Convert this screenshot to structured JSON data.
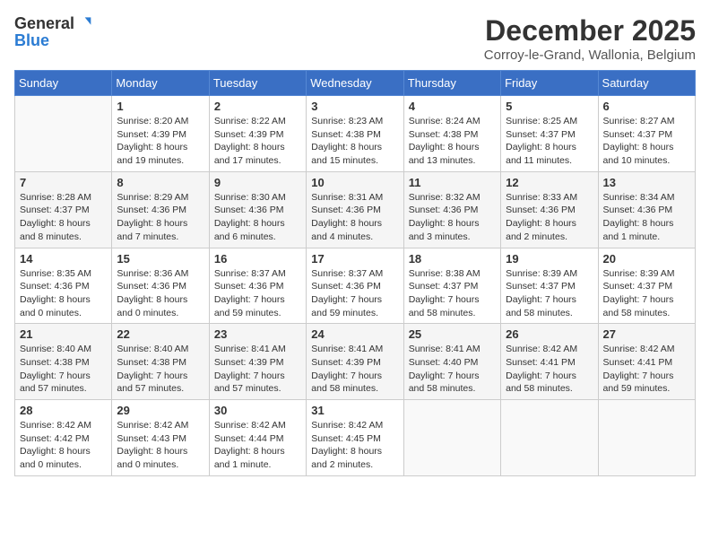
{
  "logo": {
    "text1": "General",
    "text2": "Blue"
  },
  "title": "December 2025",
  "subtitle": "Corroy-le-Grand, Wallonia, Belgium",
  "days_of_week": [
    "Sunday",
    "Monday",
    "Tuesday",
    "Wednesday",
    "Thursday",
    "Friday",
    "Saturday"
  ],
  "weeks": [
    [
      {
        "day": "",
        "info": ""
      },
      {
        "day": "1",
        "info": "Sunrise: 8:20 AM\nSunset: 4:39 PM\nDaylight: 8 hours\nand 19 minutes."
      },
      {
        "day": "2",
        "info": "Sunrise: 8:22 AM\nSunset: 4:39 PM\nDaylight: 8 hours\nand 17 minutes."
      },
      {
        "day": "3",
        "info": "Sunrise: 8:23 AM\nSunset: 4:38 PM\nDaylight: 8 hours\nand 15 minutes."
      },
      {
        "day": "4",
        "info": "Sunrise: 8:24 AM\nSunset: 4:38 PM\nDaylight: 8 hours\nand 13 minutes."
      },
      {
        "day": "5",
        "info": "Sunrise: 8:25 AM\nSunset: 4:37 PM\nDaylight: 8 hours\nand 11 minutes."
      },
      {
        "day": "6",
        "info": "Sunrise: 8:27 AM\nSunset: 4:37 PM\nDaylight: 8 hours\nand 10 minutes."
      }
    ],
    [
      {
        "day": "7",
        "info": "Sunrise: 8:28 AM\nSunset: 4:37 PM\nDaylight: 8 hours\nand 8 minutes."
      },
      {
        "day": "8",
        "info": "Sunrise: 8:29 AM\nSunset: 4:36 PM\nDaylight: 8 hours\nand 7 minutes."
      },
      {
        "day": "9",
        "info": "Sunrise: 8:30 AM\nSunset: 4:36 PM\nDaylight: 8 hours\nand 6 minutes."
      },
      {
        "day": "10",
        "info": "Sunrise: 8:31 AM\nSunset: 4:36 PM\nDaylight: 8 hours\nand 4 minutes."
      },
      {
        "day": "11",
        "info": "Sunrise: 8:32 AM\nSunset: 4:36 PM\nDaylight: 8 hours\nand 3 minutes."
      },
      {
        "day": "12",
        "info": "Sunrise: 8:33 AM\nSunset: 4:36 PM\nDaylight: 8 hours\nand 2 minutes."
      },
      {
        "day": "13",
        "info": "Sunrise: 8:34 AM\nSunset: 4:36 PM\nDaylight: 8 hours\nand 1 minute."
      }
    ],
    [
      {
        "day": "14",
        "info": "Sunrise: 8:35 AM\nSunset: 4:36 PM\nDaylight: 8 hours\nand 0 minutes."
      },
      {
        "day": "15",
        "info": "Sunrise: 8:36 AM\nSunset: 4:36 PM\nDaylight: 8 hours\nand 0 minutes."
      },
      {
        "day": "16",
        "info": "Sunrise: 8:37 AM\nSunset: 4:36 PM\nDaylight: 7 hours\nand 59 minutes."
      },
      {
        "day": "17",
        "info": "Sunrise: 8:37 AM\nSunset: 4:36 PM\nDaylight: 7 hours\nand 59 minutes."
      },
      {
        "day": "18",
        "info": "Sunrise: 8:38 AM\nSunset: 4:37 PM\nDaylight: 7 hours\nand 58 minutes."
      },
      {
        "day": "19",
        "info": "Sunrise: 8:39 AM\nSunset: 4:37 PM\nDaylight: 7 hours\nand 58 minutes."
      },
      {
        "day": "20",
        "info": "Sunrise: 8:39 AM\nSunset: 4:37 PM\nDaylight: 7 hours\nand 58 minutes."
      }
    ],
    [
      {
        "day": "21",
        "info": "Sunrise: 8:40 AM\nSunset: 4:38 PM\nDaylight: 7 hours\nand 57 minutes."
      },
      {
        "day": "22",
        "info": "Sunrise: 8:40 AM\nSunset: 4:38 PM\nDaylight: 7 hours\nand 57 minutes."
      },
      {
        "day": "23",
        "info": "Sunrise: 8:41 AM\nSunset: 4:39 PM\nDaylight: 7 hours\nand 57 minutes."
      },
      {
        "day": "24",
        "info": "Sunrise: 8:41 AM\nSunset: 4:39 PM\nDaylight: 7 hours\nand 58 minutes."
      },
      {
        "day": "25",
        "info": "Sunrise: 8:41 AM\nSunset: 4:40 PM\nDaylight: 7 hours\nand 58 minutes."
      },
      {
        "day": "26",
        "info": "Sunrise: 8:42 AM\nSunset: 4:41 PM\nDaylight: 7 hours\nand 58 minutes."
      },
      {
        "day": "27",
        "info": "Sunrise: 8:42 AM\nSunset: 4:41 PM\nDaylight: 7 hours\nand 59 minutes."
      }
    ],
    [
      {
        "day": "28",
        "info": "Sunrise: 8:42 AM\nSunset: 4:42 PM\nDaylight: 8 hours\nand 0 minutes."
      },
      {
        "day": "29",
        "info": "Sunrise: 8:42 AM\nSunset: 4:43 PM\nDaylight: 8 hours\nand 0 minutes."
      },
      {
        "day": "30",
        "info": "Sunrise: 8:42 AM\nSunset: 4:44 PM\nDaylight: 8 hours\nand 1 minute."
      },
      {
        "day": "31",
        "info": "Sunrise: 8:42 AM\nSunset: 4:45 PM\nDaylight: 8 hours\nand 2 minutes."
      },
      {
        "day": "",
        "info": ""
      },
      {
        "day": "",
        "info": ""
      },
      {
        "day": "",
        "info": ""
      }
    ]
  ]
}
